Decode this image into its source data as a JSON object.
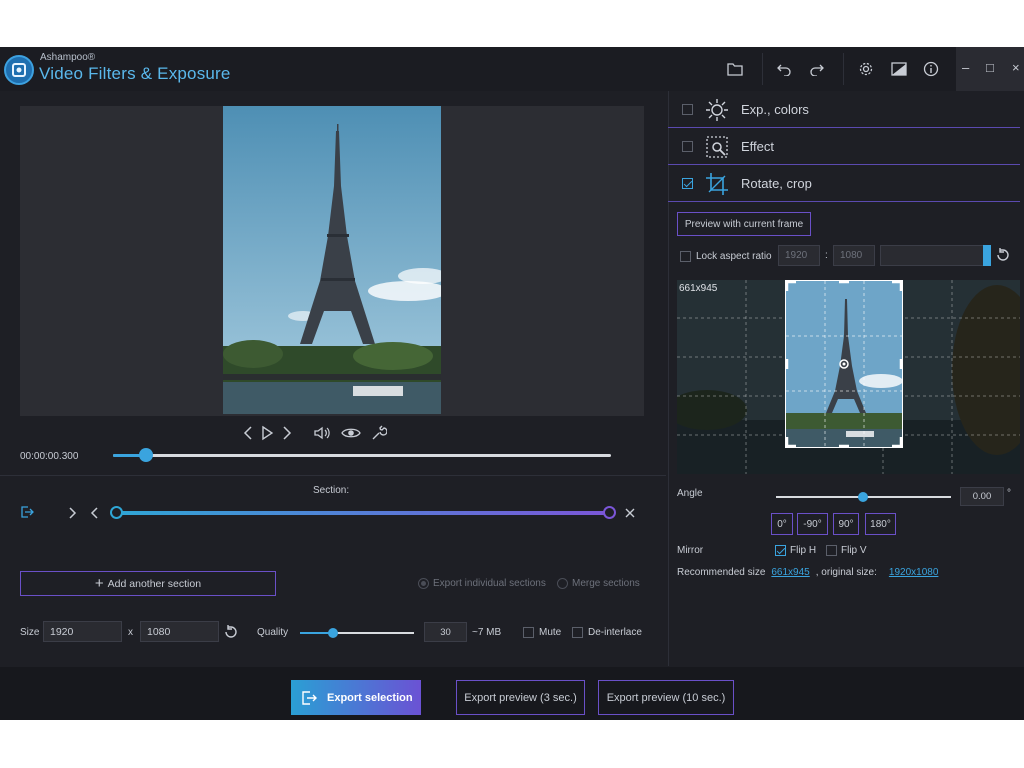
{
  "app": {
    "brand_small": "Ashampoo®",
    "title": "Video Filters & Exposure"
  },
  "toolbar": {
    "icons": [
      "folder-icon",
      "undo-icon",
      "redo-icon",
      "gear-icon",
      "picture-icon",
      "info-icon"
    ],
    "window_controls": [
      "–",
      "□",
      "×"
    ]
  },
  "player": {
    "timecode": "00:00:00.300",
    "seek_position": 0.07
  },
  "section": {
    "label": "Section:",
    "add_label": "Add another section",
    "export_individual": "Export individual sections",
    "merge": "Merge sections"
  },
  "output": {
    "size_label": "Size",
    "width": "1920",
    "x": "x",
    "height": "1080",
    "quality_label": "Quality",
    "quality_value": "30",
    "quality_fraction": 0.29,
    "size_estimate": "~7 MB",
    "mute": "Mute",
    "deinterlace": "De-interlace"
  },
  "right": {
    "sections": [
      {
        "label": "Exp., colors",
        "checked": false
      },
      {
        "label": "Effect",
        "checked": false
      },
      {
        "label": "Rotate, crop",
        "checked": true
      }
    ],
    "preview_btn": "Preview with current frame",
    "lock_aspect": "Lock aspect ratio",
    "aspect_w": "1920",
    "aspect_sep": ":",
    "aspect_h": "1080",
    "crop_label": "661x945",
    "angle_label": "Angle",
    "angle_value": "0.00",
    "degree": "°",
    "rotations": [
      "0°",
      "-90°",
      "90°",
      "180°"
    ],
    "mirror_label": "Mirror",
    "flip_h": "Flip H",
    "flip_v": "Flip V",
    "recommended_label": "Recommended size",
    "recommended_value": "661x945",
    "original_label": ", original size:",
    "original_value": "1920x1080"
  },
  "bottom": {
    "export_selection": "Export selection",
    "export_3": "Export preview (3 sec.)",
    "export_10": "Export preview (10 sec.)"
  }
}
